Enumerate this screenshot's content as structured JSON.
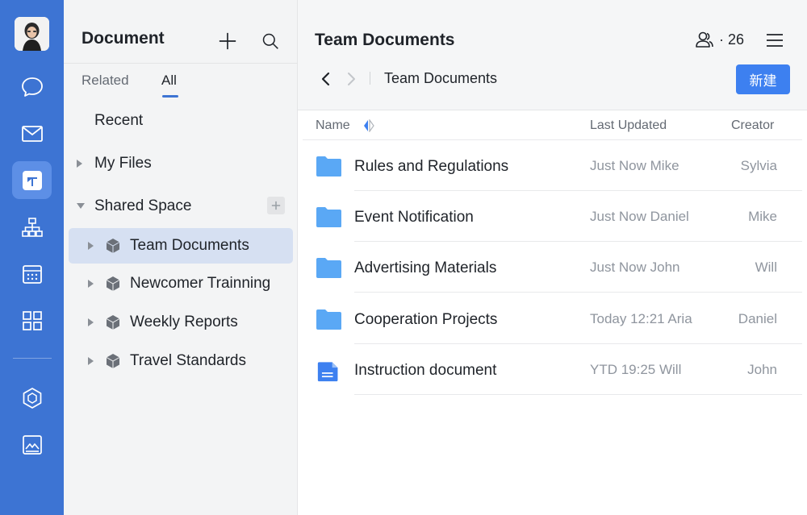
{
  "sidebar": {
    "title": "Document",
    "tabs": [
      {
        "label": "Related"
      },
      {
        "label": "All"
      }
    ],
    "items": [
      {
        "label": "Recent"
      },
      {
        "label": "My Files"
      },
      {
        "label": "Shared Space"
      }
    ],
    "shared_children": [
      {
        "label": "Team Documents"
      },
      {
        "label": "Newcomer Trainning"
      },
      {
        "label": "Weekly Reports"
      },
      {
        "label": "Travel Standards"
      }
    ]
  },
  "main": {
    "title": "Team Documents",
    "member_count": "· 26",
    "breadcrumb": "Team Documents",
    "new_button": "新建",
    "columns": {
      "name": "Name",
      "updated": "Last Updated",
      "creator": "Creator"
    },
    "rows": [
      {
        "type": "folder",
        "name": "Rules and Regulations",
        "updated": "Just Now  Mike",
        "creator": "Sylvia"
      },
      {
        "type": "folder",
        "name": "Event Notification",
        "updated": "Just Now  Daniel",
        "creator": "Mike"
      },
      {
        "type": "folder",
        "name": "Advertising Materials",
        "updated": "Just Now  John",
        "creator": "Will"
      },
      {
        "type": "folder",
        "name": "Cooperation Projects",
        "updated": "Today 12:21  Aria",
        "creator": "Daniel"
      },
      {
        "type": "document",
        "name": "Instruction document",
        "updated": "YTD 19:25  Will",
        "creator": "John"
      }
    ]
  },
  "colors": {
    "rail": "#3d74d3",
    "accent": "#3d80f0",
    "folder": "#5aa8f5",
    "selected": "#d6e0f2"
  }
}
